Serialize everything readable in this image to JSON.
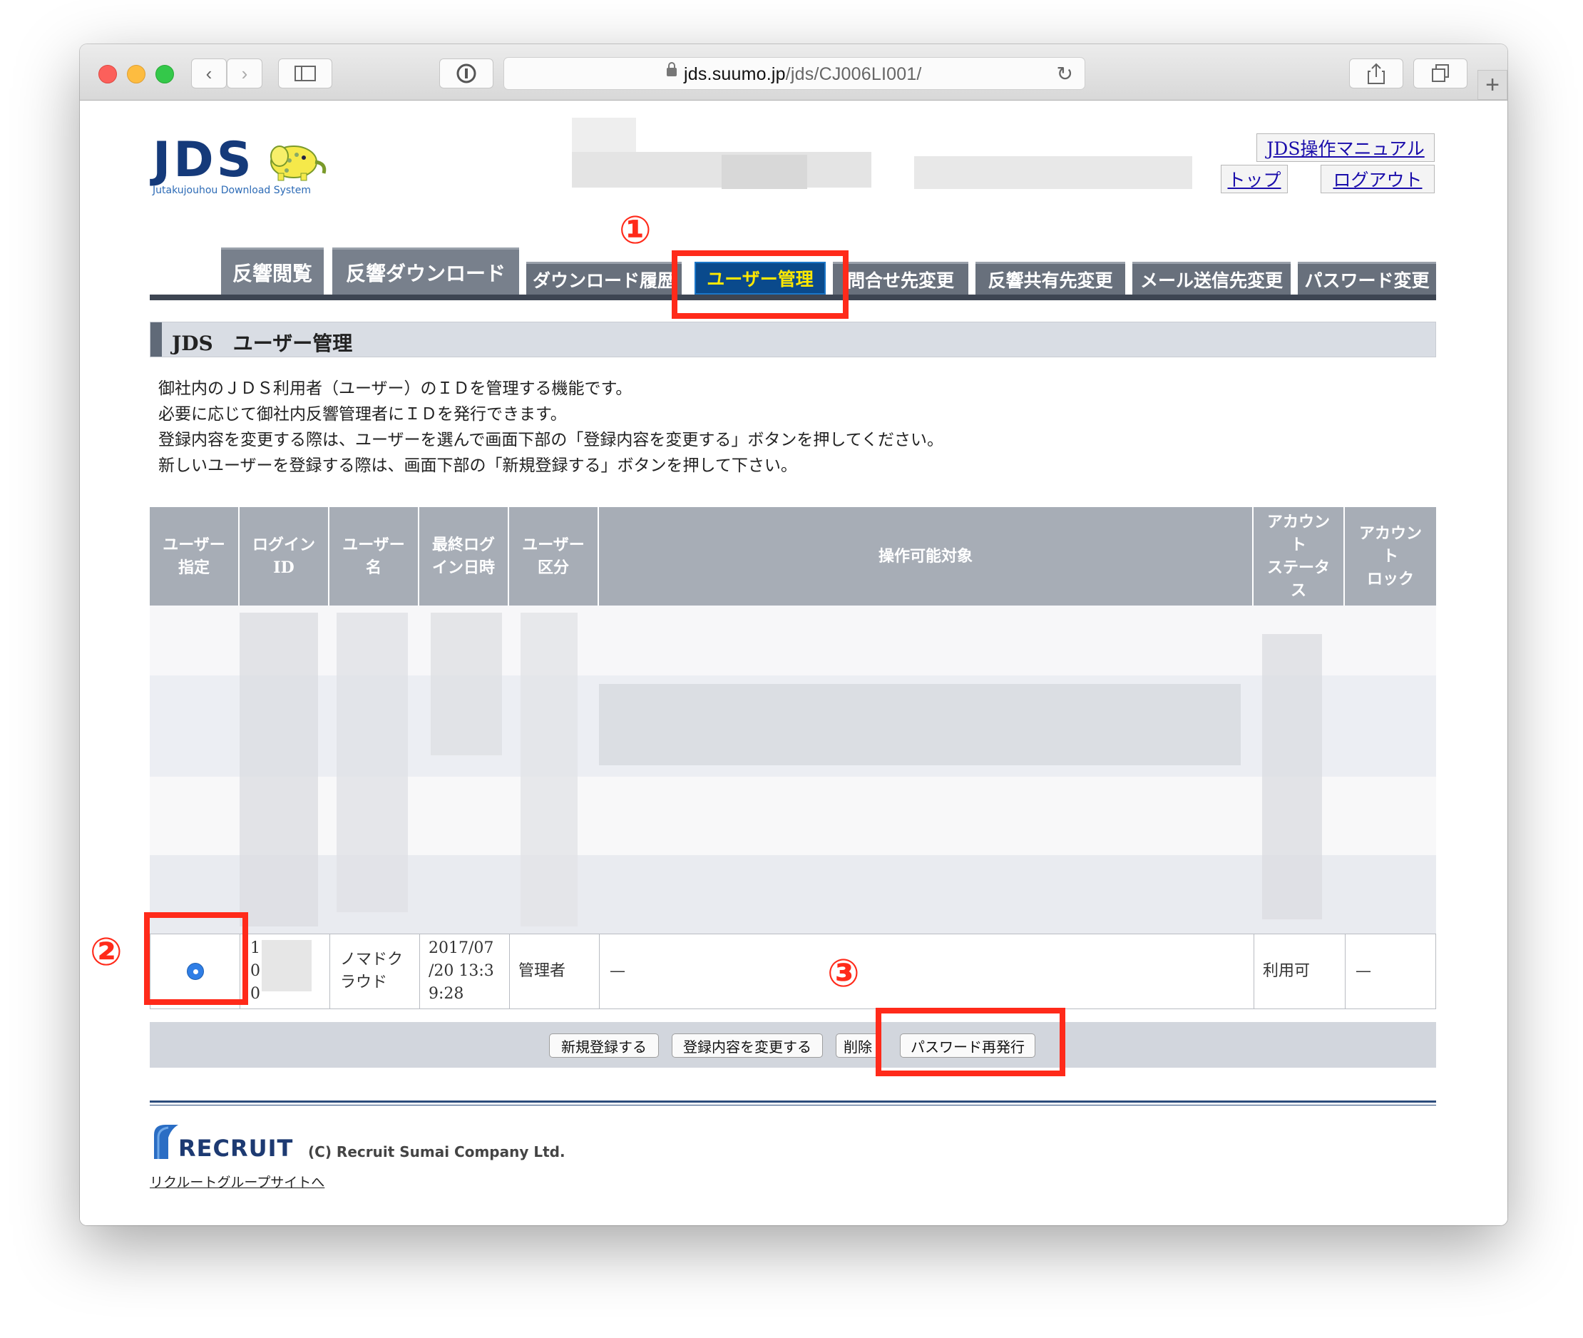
{
  "browser": {
    "url_host": "jds.suumo.jp",
    "url_path": "/jds/CJ006LI001/"
  },
  "header": {
    "logo_text": "JDS",
    "logo_tagline": "Jutakujouhou Download System",
    "manual_link": "JDS操作マニュアル",
    "top_link": "トップ",
    "logout_link": "ログアウト"
  },
  "tabs": [
    {
      "label": "反響閲覧"
    },
    {
      "label": "反響ダウンロード"
    },
    {
      "label": "ダウンロード履歴"
    },
    {
      "label": "ユーザー管理"
    },
    {
      "label": "問合せ先変更"
    },
    {
      "label": "反響共有先変更"
    },
    {
      "label": "メール送信先変更"
    },
    {
      "label": "パスワード変更"
    }
  ],
  "annotations": {
    "step1": "①",
    "step2": "②",
    "step3": "③"
  },
  "section_title": "JDS　ユーザー管理",
  "description": [
    "御社内のＪＤＳ利用者（ユーザー）のＩＤを管理する機能です。",
    "必要に応じて御社内反響管理者にＩＤを発行できます。",
    "登録内容を変更する際は、ユーザーを選んで画面下部の「登録内容を変更する」ボタンを押してください。",
    "新しいユーザーを登録する際は、画面下部の「新規登録する」ボタンを押して下さい。"
  ],
  "table": {
    "headers": [
      "ユーザー\n指定",
      "ログイン\nID",
      "ユーザー\n名",
      "最終ログ\nイン日時",
      "ユーザー\n区分",
      "操作可能対象",
      "アカウン\nト\nステータ\nス",
      "アカウン\nト\nロック"
    ],
    "visible_row": {
      "login_id": "1\n0\n0",
      "user_name": "ノマドク\nラウド",
      "last_login": "2017/07\n/20 13:3\n9:28",
      "user_type": "管理者",
      "targets": "—",
      "status": "利用可",
      "lock": "—"
    }
  },
  "buttons": {
    "new": "新規登録する",
    "edit": "登録内容を変更する",
    "delete": "削除",
    "reissue": "パスワード再発行"
  },
  "footer": {
    "company_logo": "RECRUIT",
    "copyright": "(C) Recruit Sumai Company Ltd.",
    "group_link": "リクルートグループサイトへ"
  },
  "colors": {
    "highlight_red": "#ff2a1a",
    "active_tab_bg": "#0a4a8c",
    "active_tab_text": "#ffe800",
    "tab_bg": "#78808c",
    "table_header_bg": "#a7adb6"
  }
}
